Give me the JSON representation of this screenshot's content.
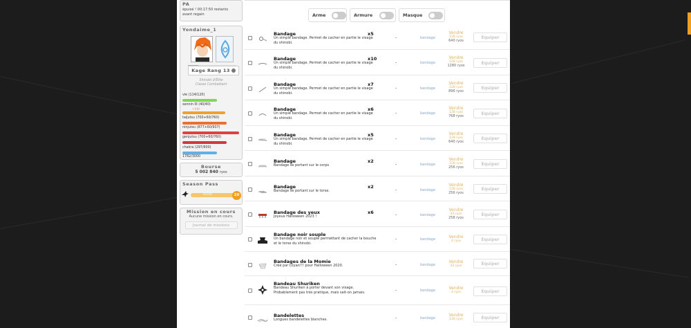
{
  "sidebar": {
    "pa": {
      "title": "PA",
      "line1": "épuisé ! 00:17:50 restants",
      "line2": "avant regain"
    },
    "profile": {
      "username": "Yondaime_1",
      "rank": "Kage Rang 13",
      "title1": "Shinobi d'Élite",
      "title2": "Classe Combattant",
      "stats": [
        {
          "label": "vie (114/120)",
          "color": "#7ed957",
          "fraction": 0.95
        },
        {
          "label": "sennin III (40/40)",
          "color": "#f0a030",
          "fraction": 1.0
        },
        {
          "label": "taijutsu (700+60/760)",
          "color": "#e87030",
          "fraction": 1.0
        },
        {
          "label": "ninjutsu (877+60/937)",
          "color": "#e04040",
          "fraction": 1.0
        },
        {
          "label": "genjutsu (700+60/760)",
          "color": "#d03a3a",
          "fraction": 1.0
        },
        {
          "label": "chakra (297/600)",
          "color": "#5fb0e8",
          "fraction": 0.5
        }
      ],
      "sennin_ticks": "I   II   III",
      "xp": "1782/3000"
    },
    "bourse": {
      "title": "Bourse",
      "amount": "5 002 840",
      "unit": "ryos"
    },
    "season": {
      "title": "Season Pass",
      "progress": "0/100",
      "level": "20"
    },
    "mission": {
      "title": "Mission en cours",
      "text": "Aucune mission en cours.",
      "button": "Journal de missions"
    }
  },
  "toggles": [
    {
      "label": "Arme"
    },
    {
      "label": "Armure"
    },
    {
      "label": "Masque"
    }
  ],
  "items": [
    {
      "name": "Bandage",
      "qty": "x5",
      "desc": "Un simple bandage. Permet de cacher en partie le visage du shinobi.",
      "dash": "-",
      "cat": "bandage",
      "sell": "Vendre",
      "unit": "128 ryos",
      "total": "640 ryos",
      "equip": "Equiper",
      "icon": "bandage-roll-icon"
    },
    {
      "name": "Bandage",
      "qty": "x10",
      "desc": "Un simple bandage. Permet de cacher en partie le visage du shinobi.",
      "dash": "-",
      "cat": "bandage",
      "sell": "Vendre",
      "unit": "128 ryos",
      "total": "1280 ryos",
      "equip": "Equiper",
      "icon": "bandage-strip-icon"
    },
    {
      "name": "Bandage",
      "qty": "x7",
      "desc": "Un simple bandage. Permet de cacher en partie le visage du shinobi.",
      "dash": "-",
      "cat": "bandage",
      "sell": "Vendre",
      "unit": "128 ryos",
      "total": "896 ryos",
      "equip": "Equiper",
      "icon": "bandage-strip-icon"
    },
    {
      "name": "Bandage",
      "qty": "x6",
      "desc": "Un simple bandage. Permet de cacher en partie le visage du shinobi.",
      "dash": "-",
      "cat": "bandage",
      "sell": "Vendre",
      "unit": "128 ryos",
      "total": "768 ryos",
      "equip": "Equiper",
      "icon": "bandage-strip-icon"
    },
    {
      "name": "Bandage",
      "qty": "x5",
      "desc": "Un simple bandage. Permet de cacher en partie le visage du shinobi.",
      "dash": "-",
      "cat": "bandage",
      "sell": "Vendre",
      "unit": "128 ryos",
      "total": "640 ryos",
      "equip": "Equiper",
      "icon": "bandage-strip-icon"
    },
    {
      "name": "Bandage",
      "qty": "x2",
      "desc": "Bandage se portant sur le corps",
      "dash": "-",
      "cat": "bandage",
      "sell": "Vendre",
      "unit": "128 ryos",
      "total": "256 ryos",
      "equip": "Equiper",
      "icon": "body-bandage-icon"
    },
    {
      "name": "Bandage",
      "qty": "x2",
      "desc": "Bandage se portant sur le torse.",
      "dash": "-",
      "cat": "bandage",
      "sell": "Vendre",
      "unit": "128 ryos",
      "total": "256 ryos",
      "equip": "Equiper",
      "icon": "torso-bandage-icon"
    },
    {
      "name": "Bandage des yeux",
      "qty": "x6",
      "desc": "Joyeux Halloween 2023 !",
      "dash": "-",
      "cat": "bandage",
      "sell": "Vendre",
      "unit": "43 ryos",
      "total": "258 ryos",
      "equip": "Equiper",
      "icon": "eye-bandage-icon"
    },
    {
      "name": "Bandage noir souple",
      "qty": "",
      "desc": "Un bandage noir et souple permettant de cacher la bouche et le torse du shinobi.",
      "dash": "-",
      "cat": "bandage",
      "sell": "Vendre",
      "unit": "4 ryos",
      "total": "",
      "equip": "Equiper",
      "icon": "black-bandage-icon"
    },
    {
      "name": "Bandages de la Momie",
      "qty": "",
      "desc": "Créé par Lilyan!!! pour Halloween 2020.",
      "dash": "-",
      "cat": "bandage",
      "sell": "Vendre",
      "unit": "43 ryos",
      "total": "",
      "equip": "Equiper",
      "icon": "mummy-bandage-icon"
    },
    {
      "name": "Bandeau Shuriken",
      "qty": "",
      "desc": "Bandeau Shuriken à porter devant son visage. Probablement pas très pratique, mais sait-on jamais.",
      "dash": "-",
      "cat": "bandage",
      "sell": "Vendre",
      "unit": "4 ryos",
      "total": "",
      "equip": "Equiper",
      "icon": "shuriken-icon"
    },
    {
      "name": "Bandelettes",
      "qty": "",
      "desc": "Longues bandelettes blanches.",
      "dash": "-",
      "cat": "bandage",
      "sell": "Vendre",
      "unit": "128 ryos",
      "total": "",
      "equip": "Equiper",
      "icon": "bandelettes-icon"
    }
  ]
}
